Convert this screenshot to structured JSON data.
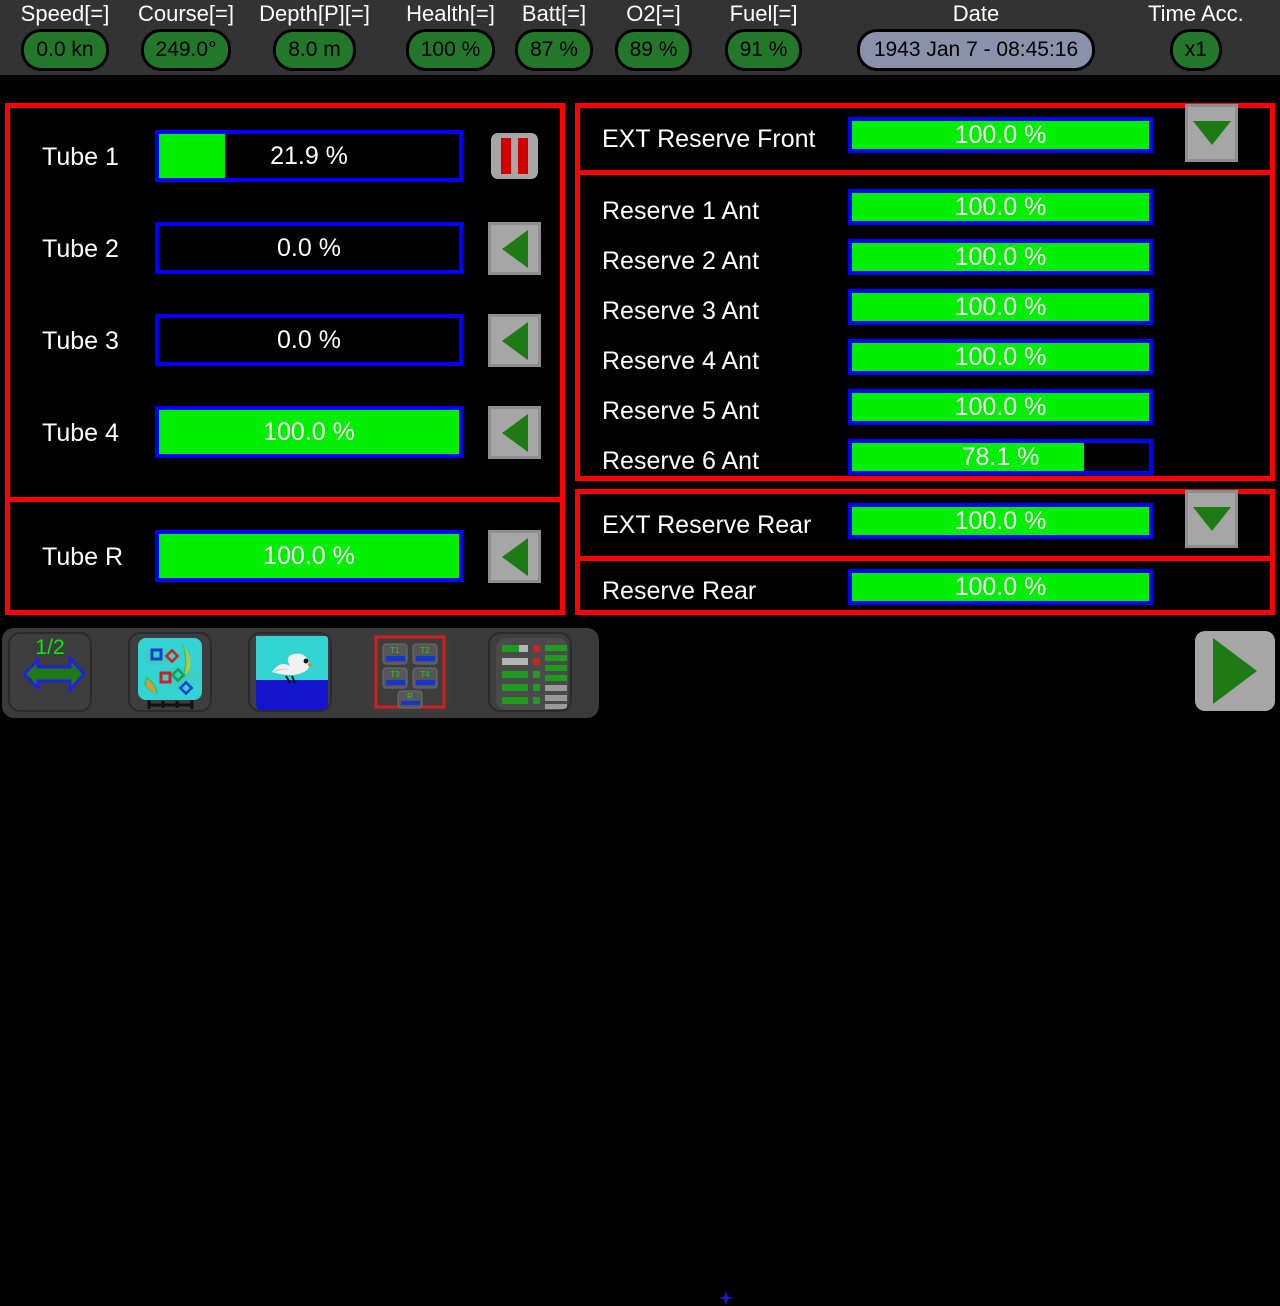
{
  "header": {
    "gauges": [
      {
        "label": "Speed[=]",
        "value": "0.0 kn",
        "type": "green"
      },
      {
        "label": "Course[=]",
        "value": "249.0°",
        "type": "green"
      },
      {
        "label": "Depth[P][=]",
        "value": "8.0 m",
        "type": "green"
      },
      {
        "label": "Health[=]",
        "value": "100 %",
        "type": "green"
      },
      {
        "label": "Batt[=]",
        "value": "87 %",
        "type": "green"
      },
      {
        "label": "O2[=]",
        "value": "89 %",
        "type": "green"
      },
      {
        "label": "Fuel[=]",
        "value": "91 %",
        "type": "green"
      },
      {
        "label": "Date",
        "value": "1943 Jan 7 - 08:45:16",
        "type": "date"
      },
      {
        "label": "Time Acc.",
        "value": "x1",
        "type": "green"
      }
    ]
  },
  "tubes": {
    "main": [
      {
        "name": "Tube 1",
        "value": "21.9 %",
        "percent": 21.9,
        "button": "pause-button",
        "icon": "pause-icon"
      },
      {
        "name": "Tube 2",
        "value": "0.0 %",
        "percent": 0.0,
        "button": "load-left-button",
        "icon": "triangle-left-icon"
      },
      {
        "name": "Tube 3",
        "value": "0.0 %",
        "percent": 0.0,
        "button": "load-left-button",
        "icon": "triangle-left-icon"
      },
      {
        "name": "Tube 4",
        "value": "100.0 %",
        "percent": 100.0,
        "button": "load-left-button",
        "icon": "triangle-left-icon"
      }
    ],
    "rear": [
      {
        "name": "Tube R",
        "value": "100.0 %",
        "percent": 100.0,
        "button": "load-left-button",
        "icon": "triangle-left-icon"
      }
    ]
  },
  "reserves_front": {
    "ext": [
      {
        "name": "EXT Reserve Front",
        "value": "100.0 %",
        "percent": 100.0,
        "button": "transfer-down-button",
        "icon": "triangle-down-icon"
      }
    ],
    "internal": [
      {
        "name": "Reserve 1 Ant",
        "value": "100.0 %",
        "percent": 100.0
      },
      {
        "name": "Reserve 2 Ant",
        "value": "100.0 %",
        "percent": 100.0
      },
      {
        "name": "Reserve 3 Ant",
        "value": "100.0 %",
        "percent": 100.0
      },
      {
        "name": "Reserve 4 Ant",
        "value": "100.0 %",
        "percent": 100.0
      },
      {
        "name": "Reserve 5 Ant",
        "value": "100.0 %",
        "percent": 100.0
      },
      {
        "name": "Reserve 6 Ant",
        "value": "78.1 %",
        "percent": 78.1
      }
    ]
  },
  "reserves_rear": {
    "ext": [
      {
        "name": "EXT Reserve Rear",
        "value": "100.0 %",
        "percent": 100.0,
        "button": "transfer-down-button",
        "icon": "triangle-down-icon"
      }
    ],
    "internal": [
      {
        "name": "Reserve Rear",
        "value": "100.0 %",
        "percent": 100.0
      }
    ]
  },
  "toolbar": {
    "page_indicator": "1/2",
    "next_page_icon": "arrow-right-icon",
    "buttons": [
      {
        "name": "next-page-button",
        "icon": "arrow-right-icon"
      },
      {
        "name": "map-view-button",
        "icon": "map-icon"
      },
      {
        "name": "periscope-view-button",
        "icon": "seagull-horizon-icon"
      },
      {
        "name": "torpedo-panel-button",
        "icon": "torpedo-tubes-icon",
        "selected": true
      },
      {
        "name": "systems-panel-button",
        "icon": "status-bars-icon"
      }
    ],
    "play_button": {
      "name": "play-button",
      "icon": "triangle-right-icon"
    }
  },
  "colors": {
    "accent_red": "#ff0000",
    "bar_border_blue": "#0000ff",
    "bar_fill_green": "#00ee00",
    "gauge_green": "#22772a",
    "date_slate": "#8b91ab",
    "button_gray": "#a6a6a6",
    "triangle_green": "#1d7a14",
    "pause_red": "#d10000",
    "header_bg": "#333333",
    "page_number_green": "#00ee00"
  }
}
